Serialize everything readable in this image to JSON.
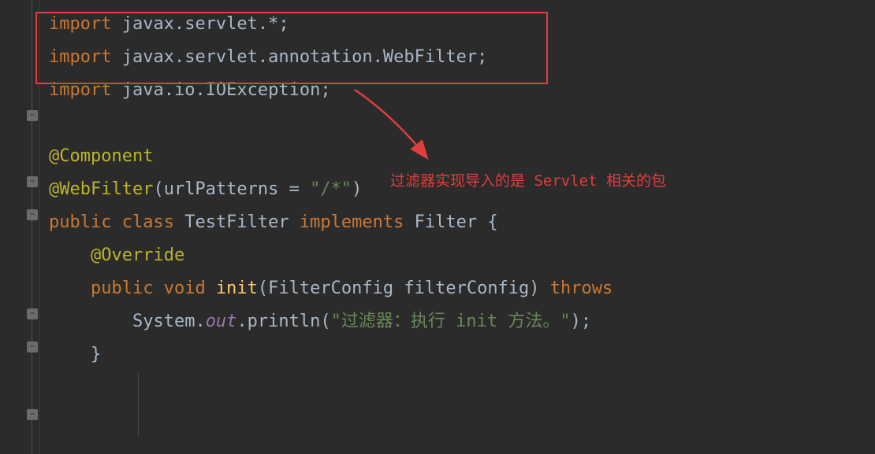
{
  "code": {
    "line1_kw": "import",
    "line1_rest": " javax.servlet.*;",
    "line2_kw": "import",
    "line2_pkg": " javax.servlet.annotation.",
    "line2_cls": "WebFilter",
    "line2_semi": ";",
    "line3_kw": "import",
    "line3_rest": " java.io.IOException;",
    "line5_anno": "@Component",
    "line6_anno": "@WebFilter",
    "line6_open": "(urlPatterns = ",
    "line6_str": "\"/*\"",
    "line6_close": ")",
    "line7_public": "public ",
    "line7_class": "class ",
    "line7_name": "TestFilter ",
    "line7_impl": "implements ",
    "line7_iface": "Filter {",
    "line8_over": "@Override",
    "line9_public": "public ",
    "line9_void": "void ",
    "line9_fn": "init",
    "line9_params": "(FilterConfig filterConfig) ",
    "line9_throws": "throws",
    "line10_sys": "System.",
    "line10_out": "out",
    "line10_print": ".println(",
    "line10_str": "\"过滤器：执行 init 方法。\"",
    "line10_close": ");",
    "line11_brace": "}"
  },
  "annotation": {
    "text": "过滤器实现导入的是 Servlet 相关的包"
  }
}
